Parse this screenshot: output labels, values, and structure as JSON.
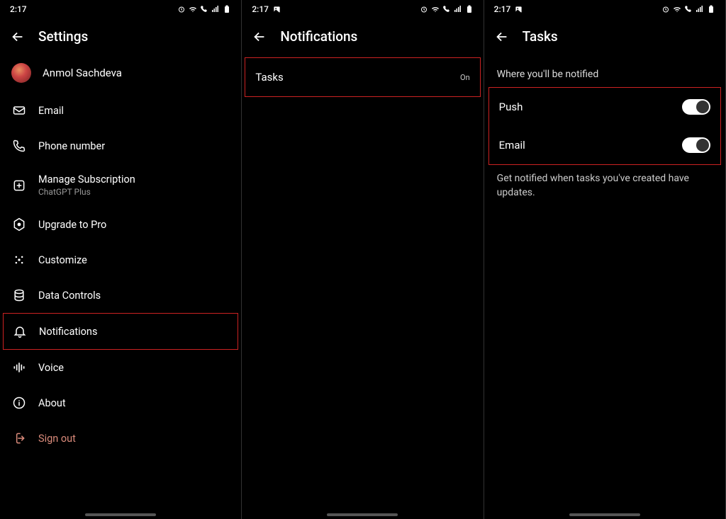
{
  "statusbar": {
    "time": "2:17"
  },
  "screen1": {
    "title": "Settings",
    "profile_name": "Anmol Sachdeva",
    "items": {
      "email": "Email",
      "phone": "Phone number",
      "subscription": "Manage Subscription",
      "subscription_sub": "ChatGPT Plus",
      "upgrade": "Upgrade to Pro",
      "customize": "Customize",
      "data": "Data Controls",
      "notifications": "Notifications",
      "voice": "Voice",
      "about": "About",
      "signout": "Sign out"
    }
  },
  "screen2": {
    "title": "Notifications",
    "row_label": "Tasks",
    "row_value": "On"
  },
  "screen3": {
    "title": "Tasks",
    "section": "Where you'll be notified",
    "push": "Push",
    "email": "Email",
    "desc": "Get notified when tasks you've created have updates."
  }
}
